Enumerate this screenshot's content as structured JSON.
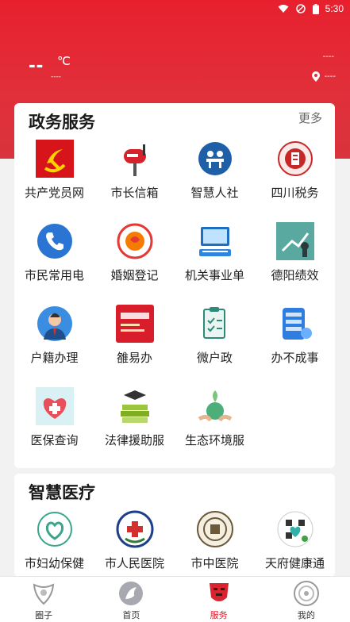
{
  "status_bar": {
    "time": "5:30",
    "icons": [
      "wifi-icon",
      "no-sim-icon",
      "battery-icon"
    ]
  },
  "weather": {
    "temp": "--",
    "unit": "℃",
    "sub": "----",
    "location_top": "----",
    "location": "----"
  },
  "gov_services": {
    "title": "政务服务",
    "more": "更多",
    "items": [
      {
        "label": "共产党员网",
        "icon": "party-emblem-icon"
      },
      {
        "label": "市长信箱",
        "icon": "mailbox-icon"
      },
      {
        "label": "智慧人社",
        "icon": "social-security-icon"
      },
      {
        "label": "四川税务",
        "icon": "tax-icon"
      },
      {
        "label": "市民常用电",
        "icon": "phone-icon"
      },
      {
        "label": "婚姻登记",
        "icon": "marriage-icon"
      },
      {
        "label": "机关事业单",
        "icon": "computer-icon"
      },
      {
        "label": "德阳绩效",
        "icon": "performance-icon"
      },
      {
        "label": "户籍办理",
        "icon": "person-icon"
      },
      {
        "label": "雒易办",
        "icon": "yiban-icon"
      },
      {
        "label": "微户政",
        "icon": "clipboard-icon"
      },
      {
        "label": "办不成事",
        "icon": "form-icon"
      },
      {
        "label": "医保查询",
        "icon": "medical-insurance-icon"
      },
      {
        "label": "法律援助服",
        "icon": "law-books-icon"
      },
      {
        "label": "生态环境服",
        "icon": "eco-globe-icon"
      }
    ]
  },
  "smart_medical": {
    "title": "智慧医疗",
    "items": [
      {
        "label": "市妇幼保健",
        "icon": "maternal-hospital-icon"
      },
      {
        "label": "市人民医院",
        "icon": "peoples-hospital-icon"
      },
      {
        "label": "市中医院",
        "icon": "tcm-hospital-icon"
      },
      {
        "label": "天府健康通",
        "icon": "health-qr-icon"
      }
    ]
  },
  "tabbar": [
    {
      "label": "圈子",
      "icon": "circle-tab-icon"
    },
    {
      "label": "首页",
      "icon": "home-tab-icon"
    },
    {
      "label": "服务",
      "icon": "service-tab-icon",
      "active": true
    },
    {
      "label": "我的",
      "icon": "profile-tab-icon"
    }
  ],
  "colors": {
    "brand_red": "#e8202e",
    "active_tab": "#d9232e"
  }
}
